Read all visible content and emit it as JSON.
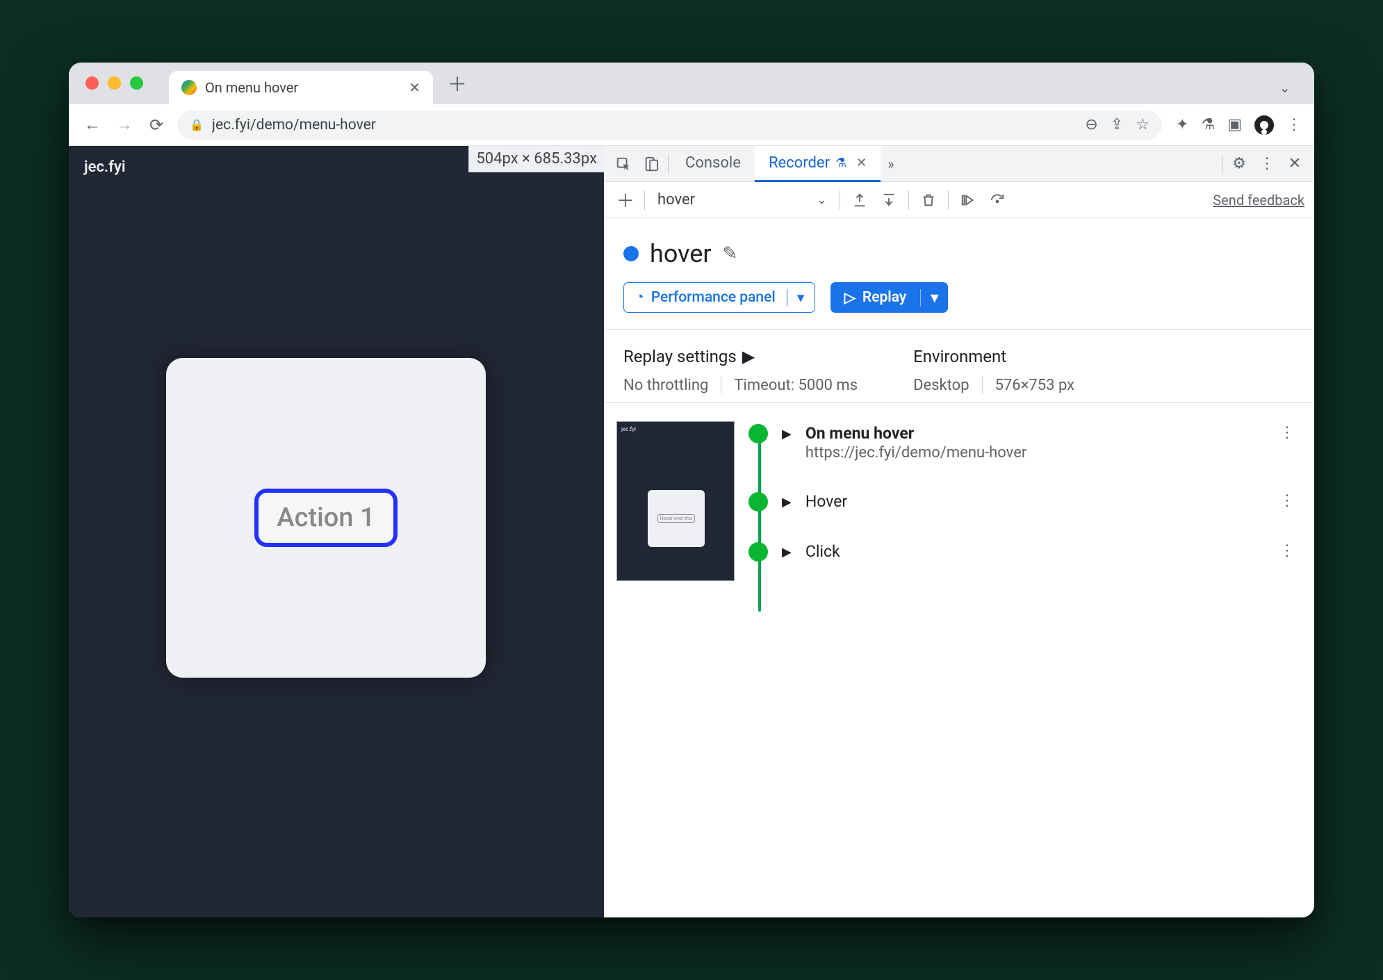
{
  "browser": {
    "tab_title": "On menu hover",
    "url": "jec.fyi/demo/menu-hover"
  },
  "viewport": {
    "site_name": "jec.fyi",
    "ruler": "504px × 685.33px",
    "action_button": "Action 1"
  },
  "devtools": {
    "tabs": {
      "console": "Console",
      "recorder": "Recorder"
    },
    "recorder_toolbar": {
      "dropdown_value": "hover",
      "feedback": "Send feedback"
    },
    "recording": {
      "name": "hover",
      "perf_button": "Performance panel",
      "replay_button": "Replay"
    },
    "settings": {
      "replay_title": "Replay settings",
      "throttling": "No throttling",
      "timeout": "Timeout: 5000 ms",
      "env_title": "Environment",
      "device": "Desktop",
      "dims": "576×753 px"
    },
    "steps": [
      {
        "title": "On menu hover",
        "sub": "https://jec.fyi/demo/menu-hover"
      },
      {
        "title": "Hover",
        "sub": ""
      },
      {
        "title": "Click",
        "sub": ""
      }
    ]
  }
}
